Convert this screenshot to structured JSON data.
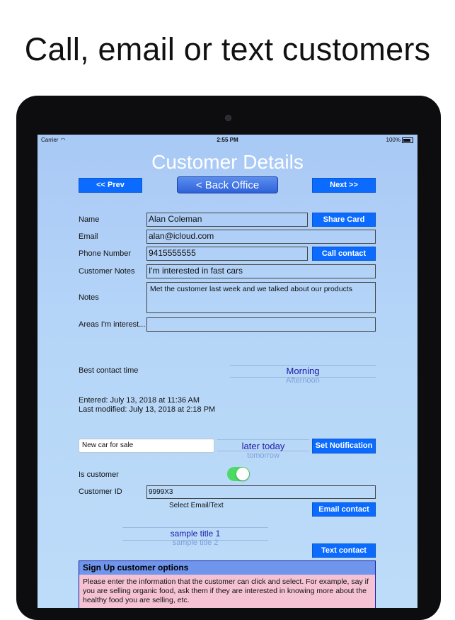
{
  "headline": "Call, email or text customers",
  "status_bar": {
    "carrier": "Carrier",
    "time": "2:55 PM",
    "battery": "100%"
  },
  "screen_title": "Customer Details",
  "nav": {
    "prev_label": "<< Prev",
    "back_label": "< Back Office",
    "next_label": "Next >>"
  },
  "form": {
    "name_label": "Name",
    "name_value": "Alan Coleman",
    "share_label": "Share Card",
    "email_label": "Email",
    "email_value": "alan@icloud.com",
    "phone_label": "Phone Number",
    "phone_value": "9415555555",
    "call_label": "Call contact",
    "customer_notes_label": "Customer Notes",
    "customer_notes_value": "I'm interested in fast cars",
    "notes_label": "Notes",
    "notes_value": "Met the customer last week and we talked about our products",
    "areas_label": "Areas I'm interest...",
    "areas_value": ""
  },
  "contact_time": {
    "label": "Best contact time",
    "selected": "Morning",
    "next": "Afternoon"
  },
  "dates": {
    "entered": "Entered: July 13, 2018 at 11:36 AM",
    "modified": "Last modified: July 13, 2018 at 2:18 PM"
  },
  "notification": {
    "text_value": "New car for sale",
    "picker_selected": "later today",
    "picker_next": "tomorrow",
    "button_label": "Set Notification"
  },
  "customer": {
    "is_customer_label": "Is customer",
    "is_customer_on": true,
    "id_label": "Customer ID",
    "id_value": "9999X3"
  },
  "messaging": {
    "select_label": "Select Email/Text",
    "email_button": "Email contact",
    "picker_selected": "sample title 1",
    "picker_next": "sample title 2",
    "text_button": "Text contact"
  },
  "signup": {
    "header": "Sign Up customer options",
    "body": "Please enter the information that the customer can click and select. For example, say if you are selling organic food, ask them if they are interested in knowing more about the healthy food you are selling, etc."
  },
  "colors": {
    "button_blue": "#0b6bff",
    "toggle_green": "#4cd964",
    "signup_header": "#6f95ec",
    "signup_body": "#f4c2d3"
  }
}
